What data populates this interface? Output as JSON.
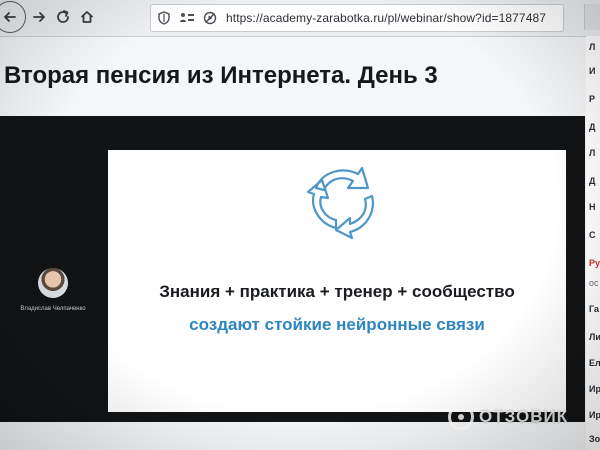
{
  "browser": {
    "url": "https://academy-zarabotka.ru/pl/webinar/show?id=1877487"
  },
  "page": {
    "title": "Вторая пенсия из Интернета. День 3"
  },
  "presenter": {
    "name": "Владислав Челпаченко"
  },
  "slide": {
    "line1": "Знания + практика + тренер + сообщество",
    "line2": "создают стойкие нейронные связи",
    "accent_color": "#2e86c1",
    "icon": "cycle-arrows-icon"
  },
  "sidebar": {
    "items": [
      {
        "text": "Л"
      },
      {
        "text": "И"
      },
      {
        "text": "Р"
      },
      {
        "text": "Д"
      },
      {
        "text": "Л"
      },
      {
        "text": "Д"
      },
      {
        "text": "Н"
      },
      {
        "text": "С"
      },
      {
        "text": "Ру"
      },
      {
        "text": "ос"
      },
      {
        "text": "Га"
      },
      {
        "text": "Ли"
      },
      {
        "text": "Ел"
      },
      {
        "text": "Ир"
      },
      {
        "text": "Ир"
      },
      {
        "text": "Зо"
      }
    ]
  },
  "watermark": {
    "text": "ОТЗОВИК"
  }
}
